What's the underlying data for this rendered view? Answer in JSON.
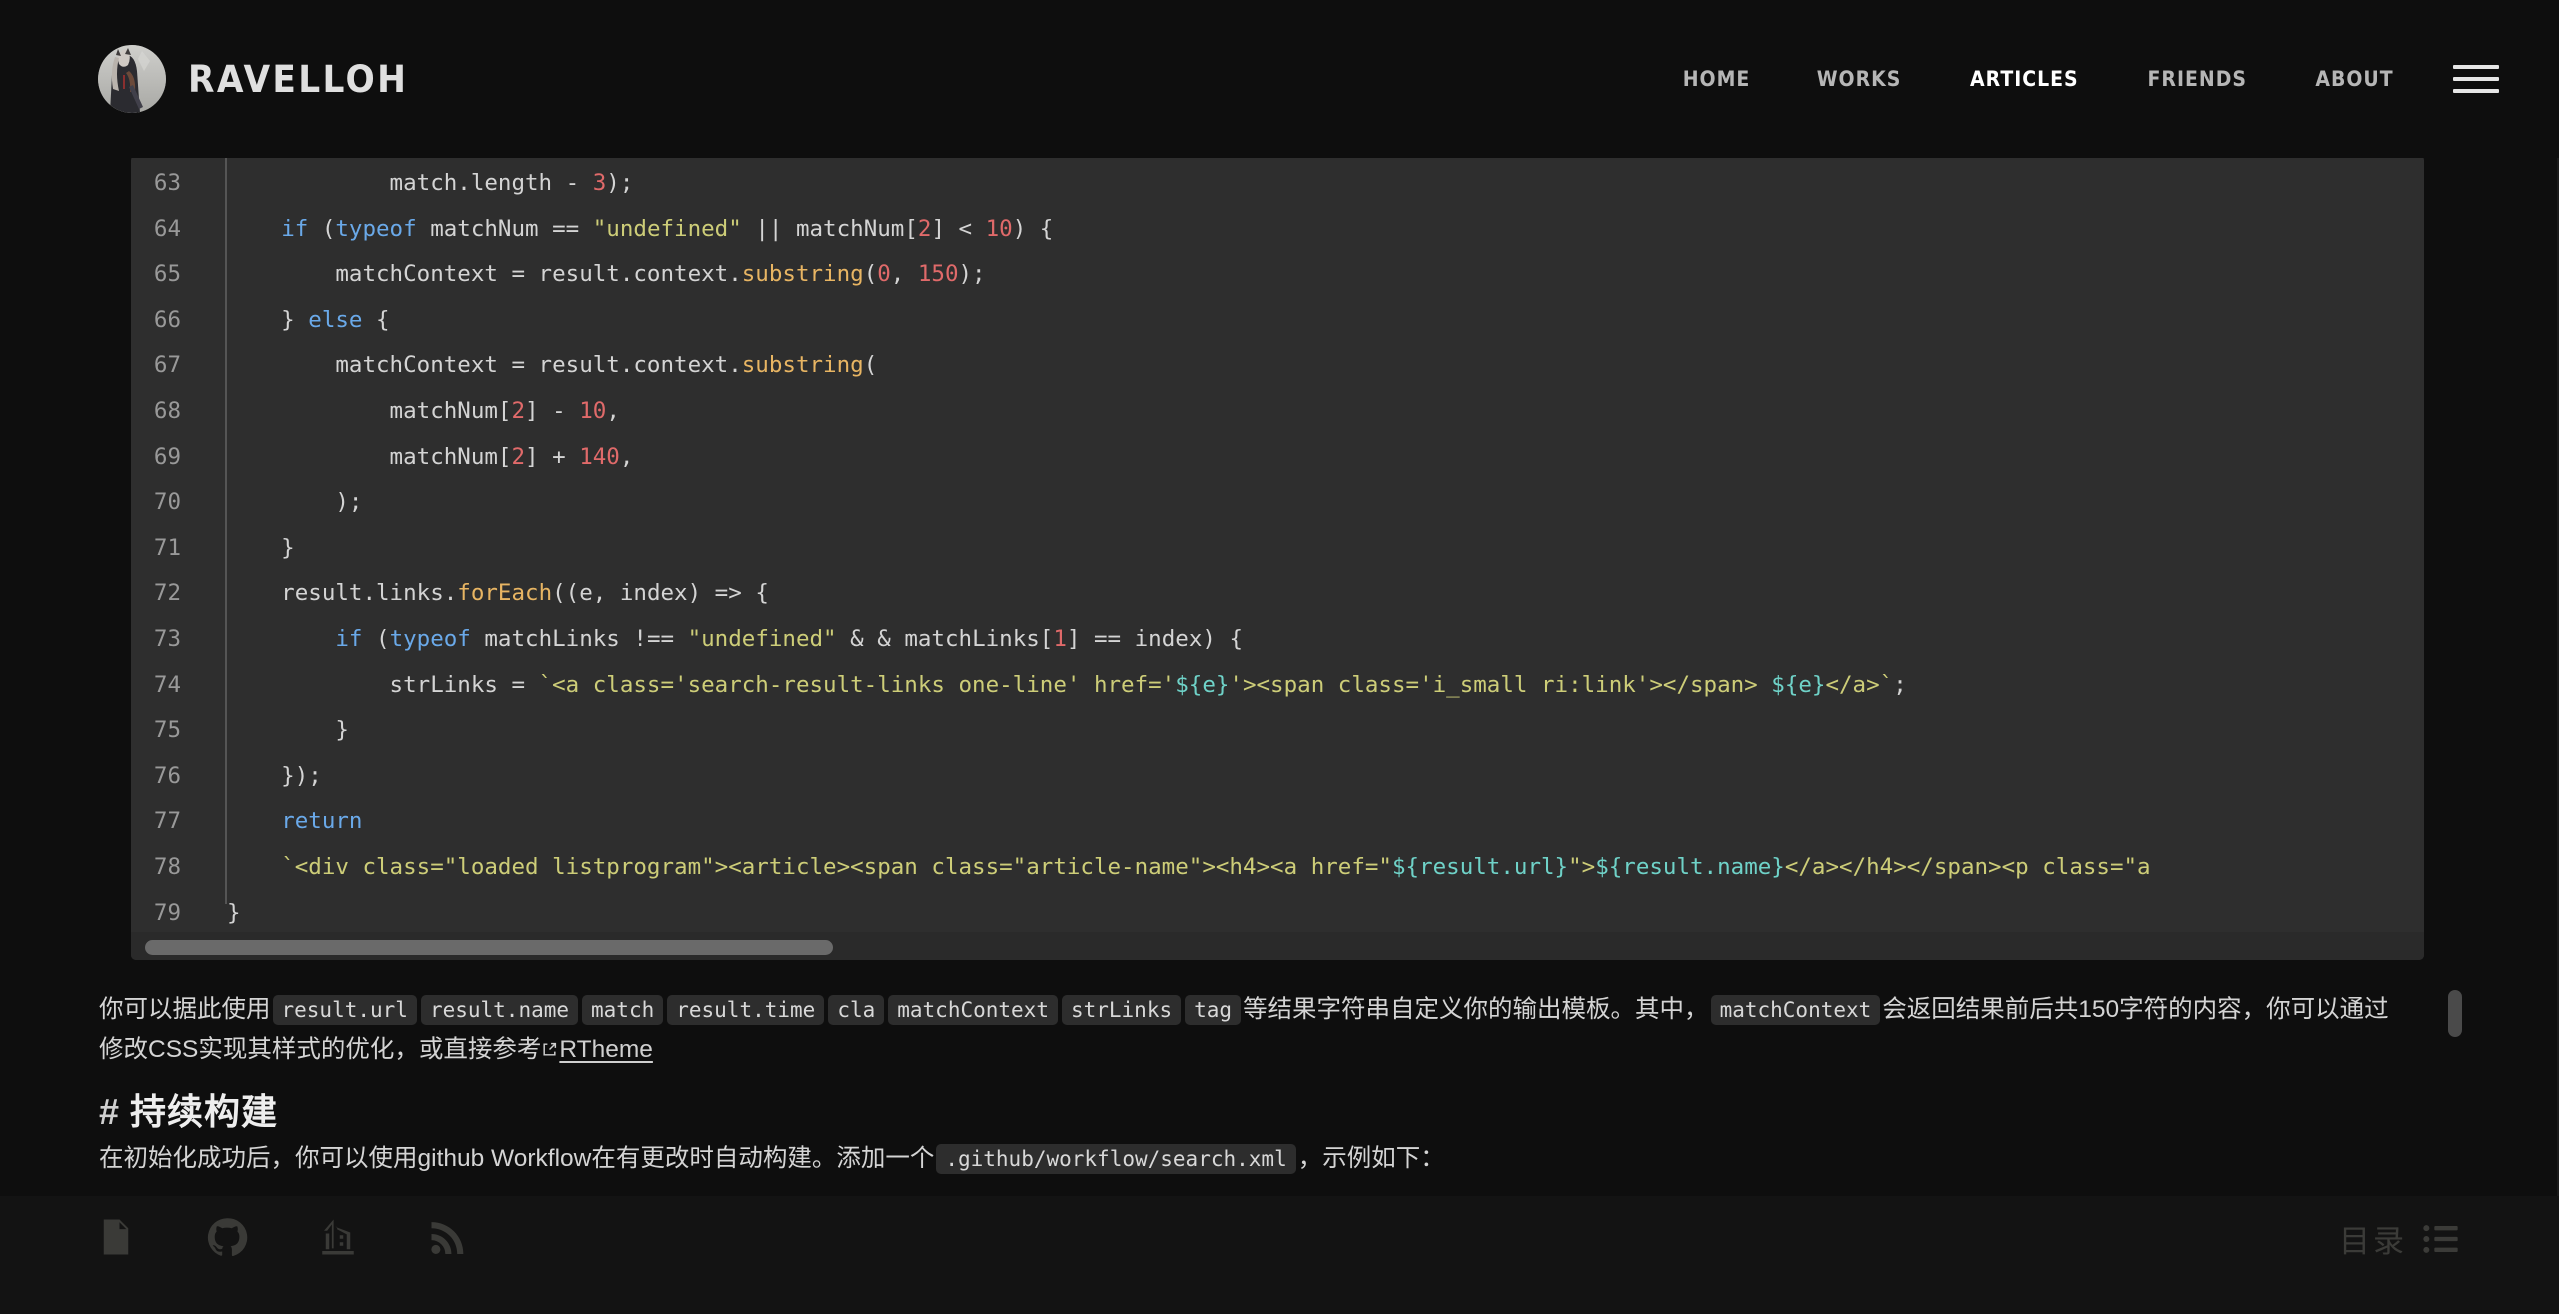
{
  "header": {
    "brand_name": "RAVELLOH",
    "avatar_alt": "avatar",
    "nav": [
      {
        "label": "HOME",
        "active": false
      },
      {
        "label": "WORKS",
        "active": false
      },
      {
        "label": "ARTICLES",
        "active": true
      },
      {
        "label": "FRIENDS",
        "active": false
      },
      {
        "label": "ABOUT",
        "active": false
      }
    ],
    "menu_icon": "hamburger-icon"
  },
  "code_block": {
    "language": "javascript",
    "first_line_number": 63,
    "lines": [
      {
        "n": "63",
        "tokens": [
          {
            "t": "            match.length - ",
            "c": "pl"
          },
          {
            "t": "3",
            "c": "num"
          },
          {
            "t": ");",
            "c": "pl"
          }
        ]
      },
      {
        "n": "64",
        "tokens": [
          {
            "t": "    ",
            "c": "pl"
          },
          {
            "t": "if",
            "c": "kw"
          },
          {
            "t": " (",
            "c": "pl"
          },
          {
            "t": "typeof",
            "c": "kw"
          },
          {
            "t": " matchNum == ",
            "c": "pl"
          },
          {
            "t": "\"undefined\"",
            "c": "str"
          },
          {
            "t": " || matchNum[",
            "c": "pl"
          },
          {
            "t": "2",
            "c": "num"
          },
          {
            "t": "] < ",
            "c": "pl"
          },
          {
            "t": "10",
            "c": "num"
          },
          {
            "t": ") {",
            "c": "pl"
          }
        ]
      },
      {
        "n": "65",
        "tokens": [
          {
            "t": "        matchContext = result.context.",
            "c": "pl"
          },
          {
            "t": "substring",
            "c": "fn"
          },
          {
            "t": "(",
            "c": "pl"
          },
          {
            "t": "0",
            "c": "num"
          },
          {
            "t": ", ",
            "c": "pl"
          },
          {
            "t": "150",
            "c": "num"
          },
          {
            "t": ");",
            "c": "pl"
          }
        ]
      },
      {
        "n": "66",
        "tokens": [
          {
            "t": "    } ",
            "c": "pl"
          },
          {
            "t": "else",
            "c": "kw"
          },
          {
            "t": " {",
            "c": "pl"
          }
        ]
      },
      {
        "n": "67",
        "tokens": [
          {
            "t": "        matchContext = result.context.",
            "c": "pl"
          },
          {
            "t": "substring",
            "c": "fn"
          },
          {
            "t": "(",
            "c": "pl"
          }
        ]
      },
      {
        "n": "68",
        "tokens": [
          {
            "t": "            matchNum[",
            "c": "pl"
          },
          {
            "t": "2",
            "c": "num"
          },
          {
            "t": "] - ",
            "c": "pl"
          },
          {
            "t": "10",
            "c": "num"
          },
          {
            "t": ",",
            "c": "pl"
          }
        ]
      },
      {
        "n": "69",
        "tokens": [
          {
            "t": "            matchNum[",
            "c": "pl"
          },
          {
            "t": "2",
            "c": "num"
          },
          {
            "t": "] + ",
            "c": "pl"
          },
          {
            "t": "140",
            "c": "num"
          },
          {
            "t": ",",
            "c": "pl"
          }
        ]
      },
      {
        "n": "70",
        "tokens": [
          {
            "t": "        );",
            "c": "pl"
          }
        ]
      },
      {
        "n": "71",
        "tokens": [
          {
            "t": "    }",
            "c": "pl"
          }
        ]
      },
      {
        "n": "72",
        "tokens": [
          {
            "t": "    result.links.",
            "c": "pl"
          },
          {
            "t": "forEach",
            "c": "fn"
          },
          {
            "t": "((e, index) => {",
            "c": "pl"
          }
        ]
      },
      {
        "n": "73",
        "tokens": [
          {
            "t": "        ",
            "c": "pl"
          },
          {
            "t": "if",
            "c": "kw"
          },
          {
            "t": " (",
            "c": "pl"
          },
          {
            "t": "typeof",
            "c": "kw"
          },
          {
            "t": " matchLinks !== ",
            "c": "pl"
          },
          {
            "t": "\"undefined\"",
            "c": "str"
          },
          {
            "t": " & & matchLinks[",
            "c": "pl"
          },
          {
            "t": "1",
            "c": "num"
          },
          {
            "t": "] == index) {",
            "c": "pl"
          }
        ]
      },
      {
        "n": "74",
        "tokens": [
          {
            "t": "            strLinks = ",
            "c": "pl"
          },
          {
            "t": "`<a class='search-result-links one-line' href='",
            "c": "str"
          },
          {
            "t": "${e}",
            "c": "tpl"
          },
          {
            "t": "'><span class='i_small ri:link'></span> ",
            "c": "str"
          },
          {
            "t": "${e}",
            "c": "tpl"
          },
          {
            "t": "</a>`",
            "c": "str"
          },
          {
            "t": ";",
            "c": "pl"
          }
        ]
      },
      {
        "n": "75",
        "tokens": [
          {
            "t": "        }",
            "c": "pl"
          }
        ]
      },
      {
        "n": "76",
        "tokens": [
          {
            "t": "    });",
            "c": "pl"
          }
        ]
      },
      {
        "n": "77",
        "tokens": [
          {
            "t": "    ",
            "c": "pl"
          },
          {
            "t": "return",
            "c": "kw"
          }
        ]
      },
      {
        "n": "78",
        "tokens": [
          {
            "t": "    ",
            "c": "pl"
          },
          {
            "t": "`<div class=\"loaded listprogram\"><article><span class=\"article-name\"><h4><a href=\"",
            "c": "str"
          },
          {
            "t": "${result.url}",
            "c": "tpl"
          },
          {
            "t": "\">",
            "c": "str"
          },
          {
            "t": "${result.name}",
            "c": "tpl"
          },
          {
            "t": "</a></h4></span><p class=\"a",
            "c": "str"
          }
        ]
      },
      {
        "n": "79",
        "tokens": [
          {
            "t": "}",
            "c": "pl"
          }
        ]
      }
    ],
    "hscrollbar": {
      "name": "code-horizontal-scrollbar",
      "thumb_fraction": 0.3
    }
  },
  "paragraph_template": {
    "part1": "你可以据此使用",
    "codes": [
      "result.url",
      "result.name",
      "match",
      "result.time",
      "cla",
      "matchContext",
      "strLinks",
      "tag"
    ],
    "part2": "等结果字符串自定义你的输出模板。其中，",
    "code_mid": "matchContext",
    "part3": "会返回结果前后共150字符的内容，你可以通过修改CSS实现其样式的优化，或直接参考",
    "link_text": "RTheme"
  },
  "heading_build": {
    "hash": "#",
    "text": "持续构建"
  },
  "paragraph_workflow": {
    "part1": "在初始化成功后，你可以使用github Workflow在有更改时自动构建。添加一个",
    "code": ".github/workflow/search.xml",
    "part2": "，示例如下："
  },
  "footer": {
    "icons": [
      {
        "name": "file-info-icon"
      },
      {
        "name": "github-icon"
      },
      {
        "name": "organization-icon"
      },
      {
        "name": "rss-icon"
      }
    ],
    "toc_label": "目录",
    "toc_icon": "list-icon"
  },
  "colors": {
    "page_bg": "#0e0e0e",
    "code_bg": "#2e2e2e",
    "footer_bg": "#131313",
    "text": "#d4d4d4",
    "nav_inactive": "#b6b6b6",
    "nav_active": "#ffffff",
    "syntax_keyword": "#6aa9e9",
    "syntax_string": "#cdcd78",
    "syntax_number": "#e06a6a",
    "syntax_function": "#e8b563",
    "syntax_template": "#6fd2c8",
    "line_number": "#999999"
  }
}
